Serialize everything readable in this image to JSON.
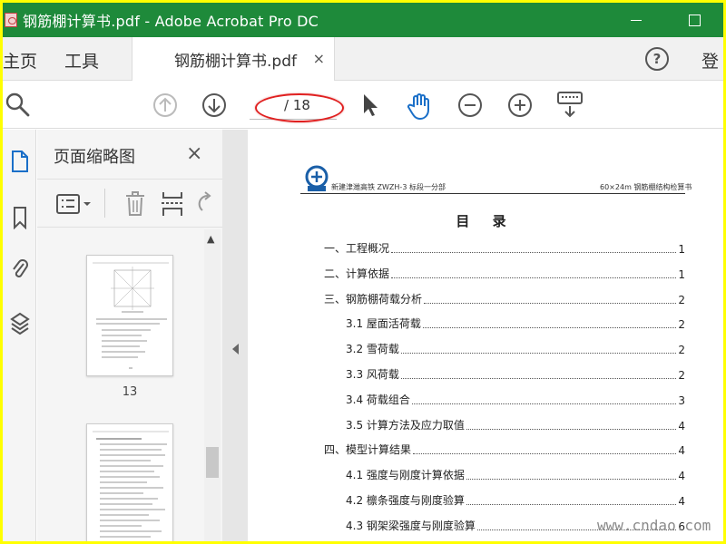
{
  "window": {
    "title": "钢筋棚计算书.pdf - Adobe Acrobat Pro DC",
    "title_bar_color": "#1e8a3a",
    "highlight_border_color": "#ffff00"
  },
  "tabs": {
    "home": "主页",
    "tools": "工具",
    "document": "钢筋棚计算书.pdf",
    "close": "×",
    "help": "?",
    "login": "登"
  },
  "toolbar": {
    "page_indicator": "/ 18",
    "icons": [
      "search-icon",
      "prev-page-icon",
      "next-page-icon",
      "select-arrow-icon",
      "hand-tool-icon",
      "zoom-out-icon",
      "zoom-in-icon",
      "keyboard-icon"
    ]
  },
  "sidebar": {
    "icons": [
      "page-thumbnails-icon",
      "bookmark-icon",
      "attachment-icon",
      "layers-icon"
    ]
  },
  "thumbnails_panel": {
    "title": "页面缩略图",
    "close": "×",
    "tool_icons": [
      "options-menu-icon",
      "trash-icon",
      "crop-icon",
      "rotate-icon"
    ],
    "thumbnails": [
      {
        "page_label": "13"
      },
      {
        "page_label": ""
      }
    ]
  },
  "document": {
    "header_left": "新建津潍高铁 ZWZH-3 标段一分部",
    "header_right": "60×24m 钢筋棚结构检算书",
    "heading": "目 录",
    "toc": [
      {
        "label": "一、工程概况",
        "page": "1",
        "level": 1
      },
      {
        "label": "二、计算依据",
        "page": "1",
        "level": 1
      },
      {
        "label": "三、钢筋棚荷载分析",
        "page": "2",
        "level": 1
      },
      {
        "label": "3.1  屋面活荷载",
        "page": "2",
        "level": 2
      },
      {
        "label": "3.2  雪荷载",
        "page": "2",
        "level": 2
      },
      {
        "label": "3.3  风荷载",
        "page": "2",
        "level": 2
      },
      {
        "label": "3.4  荷载组合",
        "page": "3",
        "level": 2
      },
      {
        "label": "3.5  计算方法及应力取值",
        "page": "4",
        "level": 2
      },
      {
        "label": "四、模型计算结果",
        "page": "4",
        "level": 1
      },
      {
        "label": "4.1  强度与刚度计算依据",
        "page": "4",
        "level": 2
      },
      {
        "label": "4.2  檩条强度与刚度验算",
        "page": "4",
        "level": 2
      },
      {
        "label": "4.3  钢架梁强度与刚度验算",
        "page": "6",
        "level": 2
      }
    ]
  },
  "watermark": "www.cndao.com"
}
